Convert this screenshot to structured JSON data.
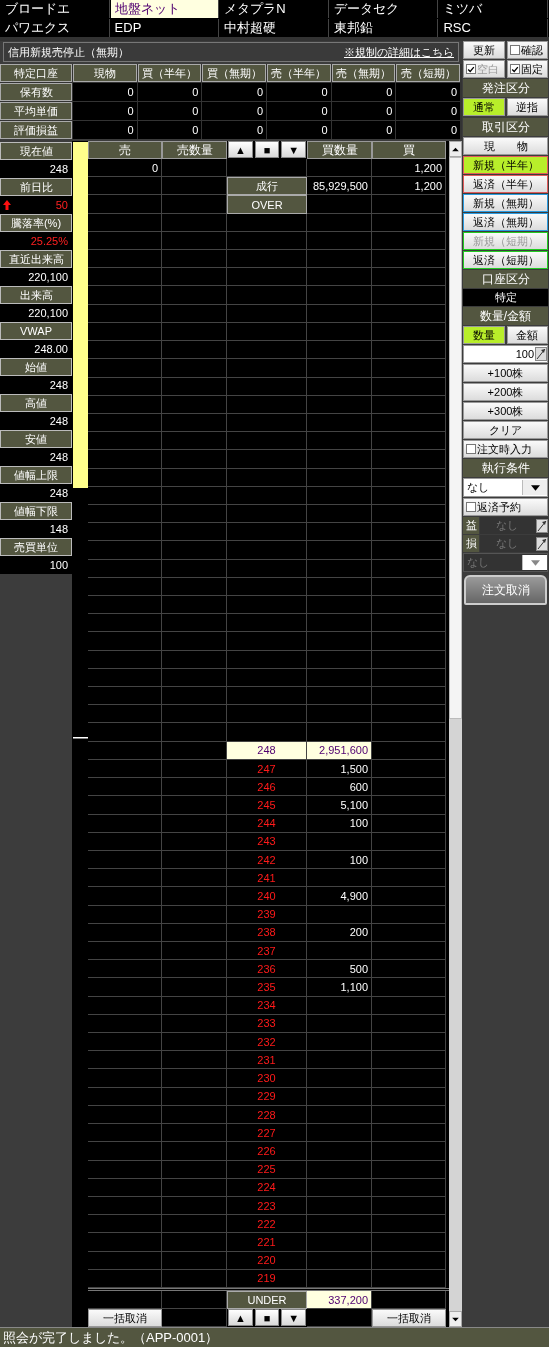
{
  "stock_tabs": [
    {
      "label": "ブロードエ",
      "selected": false
    },
    {
      "label": "地盤ネット",
      "selected": true
    },
    {
      "label": "メタプラN",
      "selected": false
    },
    {
      "label": "データセク",
      "selected": false
    },
    {
      "label": "ミツバ",
      "selected": false
    },
    {
      "label": "パワエクス",
      "selected": false
    },
    {
      "label": "EDP",
      "selected": false
    },
    {
      "label": "中村超硬",
      "selected": false
    },
    {
      "label": "東邦鉛",
      "selected": false
    },
    {
      "label": "RSC",
      "selected": false
    }
  ],
  "restriction": {
    "notice": "信用新規売停止（無期）",
    "link": "※規制の詳細はこちら"
  },
  "toolbar": {
    "refresh_button": "更新",
    "confirm": {
      "label": "確認",
      "checked": false,
      "disabled": false
    },
    "blank": {
      "label": "空白",
      "checked": true,
      "disabled": true
    },
    "fixed": {
      "label": "固定",
      "checked": true,
      "disabled": false
    }
  },
  "holdings": {
    "columns": [
      "特定口座",
      "現物",
      "買（半年）",
      "買（無期）",
      "売（半年）",
      "売（無期）",
      "売（短期）"
    ],
    "rows": [
      {
        "label": "保有数",
        "values": [
          "0",
          "0",
          "0",
          "0",
          "0",
          "0"
        ]
      },
      {
        "label": "平均単価",
        "values": [
          "0",
          "0",
          "0",
          "0",
          "0",
          "0"
        ]
      },
      {
        "label": "評価損益",
        "values": [
          "0",
          "0",
          "0",
          "0",
          "0",
          "0"
        ]
      }
    ]
  },
  "stats": [
    {
      "label": "現在値",
      "value": "248",
      "rising": false,
      "arrow": false
    },
    {
      "label": "前日比",
      "value": "50",
      "rising": true,
      "arrow": true
    },
    {
      "label": "騰落率(%)",
      "value": "25.25%",
      "rising": true,
      "arrow": false
    },
    {
      "label": "直近出来高",
      "value": "220,100",
      "rising": false,
      "arrow": false
    },
    {
      "label": "出来高",
      "value": "220,100",
      "rising": false,
      "arrow": false
    },
    {
      "label": "VWAP",
      "value": "248.00",
      "rising": false,
      "arrow": false
    },
    {
      "label": "始値",
      "value": "248",
      "rising": false,
      "arrow": false
    },
    {
      "label": "高値",
      "value": "248",
      "rising": false,
      "arrow": false
    },
    {
      "label": "安値",
      "value": "248",
      "rising": false,
      "arrow": false
    },
    {
      "label": "値幅上限",
      "value": "248",
      "rising": false,
      "arrow": false
    },
    {
      "label": "値幅下限",
      "value": "148",
      "rising": false,
      "arrow": false
    },
    {
      "label": "売買単位",
      "value": "100",
      "rising": false,
      "arrow": false
    }
  ],
  "board": {
    "columns": [
      "売",
      "売数量",
      "買数量",
      "買"
    ],
    "nav": [
      "▲",
      "■",
      "▼"
    ],
    "rows": [
      {
        "kind": "quote",
        "sell": "0",
        "buy": "1,200"
      },
      {
        "kind": "label",
        "price": "成行",
        "buy_qty": "85,929,500",
        "buy": "1,200"
      },
      {
        "kind": "label",
        "price": "OVER"
      },
      {
        "kind": "blank"
      },
      {
        "kind": "blank"
      },
      {
        "kind": "blank"
      },
      {
        "kind": "blank"
      },
      {
        "kind": "blank"
      },
      {
        "kind": "blank"
      },
      {
        "kind": "blank"
      },
      {
        "kind": "blank"
      },
      {
        "kind": "blank"
      },
      {
        "kind": "blank"
      },
      {
        "kind": "blank"
      },
      {
        "kind": "blank"
      },
      {
        "kind": "blank"
      },
      {
        "kind": "blank"
      },
      {
        "kind": "blank"
      },
      {
        "kind": "blank"
      },
      {
        "kind": "blank"
      },
      {
        "kind": "blank"
      },
      {
        "kind": "blank"
      },
      {
        "kind": "blank"
      },
      {
        "kind": "blank"
      },
      {
        "kind": "blank"
      },
      {
        "kind": "blank"
      },
      {
        "kind": "blank"
      },
      {
        "kind": "blank"
      },
      {
        "kind": "blank"
      },
      {
        "kind": "blank"
      },
      {
        "kind": "blank"
      },
      {
        "kind": "blank"
      },
      {
        "kind": "price",
        "price": "248",
        "buy_qty": "2,951,600",
        "current": true
      },
      {
        "kind": "price",
        "price": "247",
        "buy_qty": "1,500",
        "current": false
      },
      {
        "kind": "price",
        "price": "246",
        "buy_qty": "600",
        "current": false
      },
      {
        "kind": "price",
        "price": "245",
        "buy_qty": "5,100",
        "current": false
      },
      {
        "kind": "price",
        "price": "244",
        "buy_qty": "100",
        "current": false
      },
      {
        "kind": "price",
        "price": "243",
        "current": false
      },
      {
        "kind": "price",
        "price": "242",
        "buy_qty": "100",
        "current": false
      },
      {
        "kind": "price",
        "price": "241",
        "current": false
      },
      {
        "kind": "price",
        "price": "240",
        "buy_qty": "4,900",
        "current": false
      },
      {
        "kind": "price",
        "price": "239",
        "current": false
      },
      {
        "kind": "price",
        "price": "238",
        "buy_qty": "200",
        "current": false
      },
      {
        "kind": "price",
        "price": "237",
        "current": false
      },
      {
        "kind": "price",
        "price": "236",
        "buy_qty": "500",
        "current": false
      },
      {
        "kind": "price",
        "price": "235",
        "buy_qty": "1,100",
        "current": false
      },
      {
        "kind": "price",
        "price": "234",
        "current": false
      },
      {
        "kind": "price",
        "price": "233",
        "current": false
      },
      {
        "kind": "price",
        "price": "232",
        "current": false
      },
      {
        "kind": "price",
        "price": "231",
        "current": false
      },
      {
        "kind": "price",
        "price": "230",
        "current": false
      },
      {
        "kind": "price",
        "price": "229",
        "current": false
      },
      {
        "kind": "price",
        "price": "228",
        "current": false
      },
      {
        "kind": "price",
        "price": "227",
        "current": false
      },
      {
        "kind": "price",
        "price": "226",
        "current": false
      },
      {
        "kind": "price",
        "price": "225",
        "current": false
      },
      {
        "kind": "price",
        "price": "224",
        "current": false
      },
      {
        "kind": "price",
        "price": "223",
        "current": false
      },
      {
        "kind": "price",
        "price": "222",
        "current": false
      },
      {
        "kind": "price",
        "price": "221",
        "current": false
      },
      {
        "kind": "price",
        "price": "220",
        "current": false
      },
      {
        "kind": "price",
        "price": "219",
        "current": false
      }
    ],
    "under": {
      "label": "UNDER",
      "buy_qty": "337,200"
    },
    "footer": {
      "cancel_sell": "一括取消",
      "nav": [
        "▲",
        "■",
        "▼"
      ],
      "cancel_buy": "一括取消"
    }
  },
  "order_panel": {
    "order_type": {
      "title": "発注区分",
      "options": [
        {
          "label": "通常",
          "selected": true
        },
        {
          "label": "逆指",
          "selected": false
        }
      ]
    },
    "trade_type": {
      "title": "取引区分",
      "options": [
        {
          "label": "現　　物",
          "selected": false,
          "disabled": false
        },
        {
          "label": "新規（半年）",
          "selected": true,
          "disabled": false,
          "color": "#e05a5a"
        },
        {
          "label": "返済（半年）",
          "selected": false,
          "disabled": false,
          "color": "#e05a5a"
        },
        {
          "label": "新規（無期）",
          "selected": false,
          "disabled": false,
          "color": "#2a9be0"
        },
        {
          "label": "返済（無期）",
          "selected": false,
          "disabled": false,
          "color": "#2a9be0"
        },
        {
          "label": "新規（短期）",
          "selected": false,
          "disabled": true,
          "color": "#22cc22"
        },
        {
          "label": "返済（短期）",
          "selected": false,
          "disabled": false,
          "color": "#22cc22"
        }
      ]
    },
    "account": {
      "title": "口座区分",
      "value": "特定"
    },
    "quantity": {
      "title": "数量/金額",
      "modes": [
        {
          "label": "数量",
          "selected": true
        },
        {
          "label": "金額",
          "selected": false
        }
      ],
      "value": "100",
      "buttons": [
        "+100株",
        "+200株",
        "+300株",
        "クリア"
      ],
      "input_on_order": {
        "label": "注文時入力",
        "checked": false
      }
    },
    "execution": {
      "title": "執行条件",
      "value": "なし",
      "repay_reserve": {
        "label": "返済予約",
        "checked": false
      },
      "profit": {
        "label": "益",
        "value": "なし",
        "disabled": true
      },
      "loss": {
        "label": "損",
        "value": "なし",
        "disabled": true
      },
      "condition": {
        "value": "なし",
        "disabled": true
      }
    },
    "cancel_button": "注文取消"
  },
  "status_bar": "照会が完了しました。（APP-0001）"
}
